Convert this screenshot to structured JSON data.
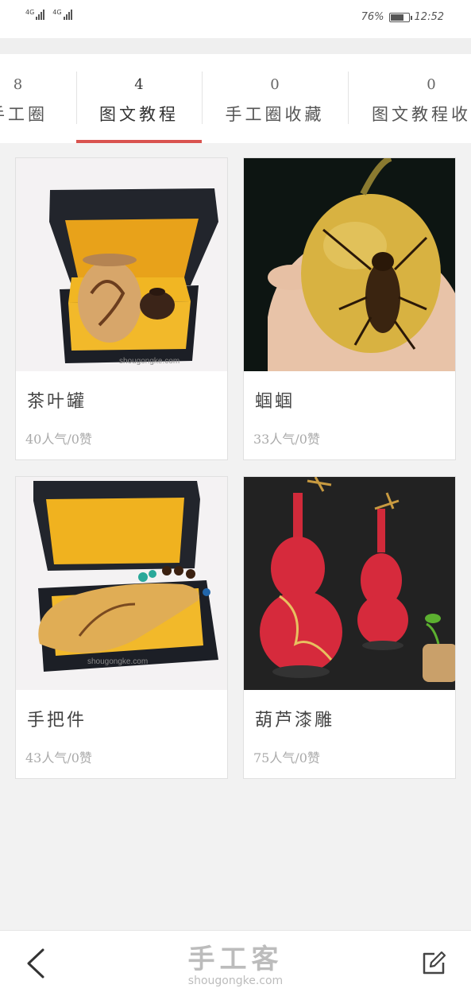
{
  "status_bar": {
    "sim1_label": "4G",
    "sim2_label": "4G",
    "battery_percent_text": "76%",
    "battery_level": 0.76,
    "time": "12:52"
  },
  "tabs": [
    {
      "count": "8",
      "label": "手工圈",
      "active": false
    },
    {
      "count": "4",
      "label": "图文教程",
      "active": true
    },
    {
      "count": "0",
      "label": "手工圈收藏",
      "active": false
    },
    {
      "count": "0",
      "label": "图文教程收藏",
      "active": false
    }
  ],
  "cards": [
    {
      "title": "茶叶罐",
      "meta": "40人气/0赞",
      "watermark": "shougongke.com"
    },
    {
      "title": "蝈蝈",
      "meta": "33人气/0赞"
    },
    {
      "title": "手把件",
      "meta": "43人气/0赞",
      "watermark": "shougongke.com"
    },
    {
      "title": "葫芦漆雕",
      "meta": "75人气/0赞"
    }
  ],
  "bottom_bar": {
    "logo_cn": "手工客",
    "logo_en": "shougongke.com",
    "back_icon": "chevron-left-icon",
    "edit_icon": "edit-icon"
  },
  "colors": {
    "accent": "#d9534f",
    "background": "#f2f2f2"
  }
}
